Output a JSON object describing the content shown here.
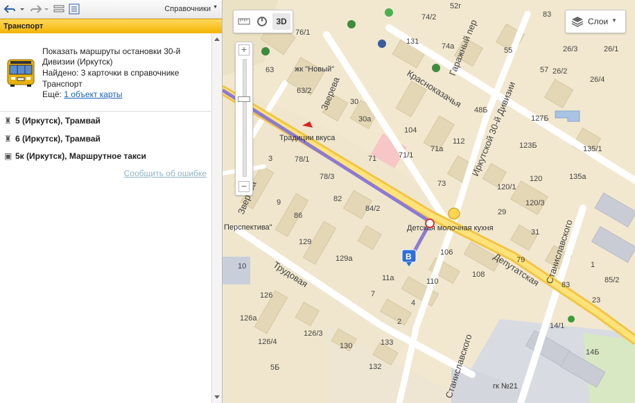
{
  "toolbar": {
    "directories_label": "Справочники"
  },
  "section": {
    "title": "Транспорт"
  },
  "card": {
    "line1": "Показать маршруты остановки 30-й",
    "line2": "Дивизии (Иркутск)",
    "line3": "Найдено: 3 карточки в справочнике",
    "line4": "Транспорт",
    "more_prefix": "Ещё:",
    "more_link": "1 объект карты"
  },
  "routes": [
    {
      "label": "5 (Иркутск), Трамвай",
      "icon": "tram-icon"
    },
    {
      "label": "6 (Иркутск), Трамвай",
      "icon": "tram-icon"
    },
    {
      "label": "5к (Иркутск), Маршрутное такси",
      "icon": "bus-icon"
    }
  ],
  "report_link": "Сообщить об ошибке",
  "map": {
    "view_3d": "3D",
    "layers_label": "Слои",
    "streets": {
      "krasnokazachya": "Красноказачья",
      "zvereva": "Зверева",
      "irkutskoy30": "Иркутской 30-й Дивизии",
      "garazhny": "Гаражный пер",
      "trudovaya": "Трудовая",
      "deputatskaya": "Депутатская",
      "stanislavskogo": "Станиславского"
    },
    "poi": {
      "tradition": "Традиции вкуса",
      "zhk": "жк \"Новый\"",
      "perspektiva": "Перспектива\"",
      "kitchen": "Детская молочная кухня",
      "gk": "гк №21"
    },
    "stop_marker": "В",
    "house_numbers": [
      "52г",
      "74/2",
      "76/1",
      "83",
      "131",
      "74а",
      "26/3",
      "26/1",
      "55",
      "63",
      "63/2",
      "57",
      "26/2",
      "26/4",
      "30",
      "48Б",
      "30а",
      "104",
      "127Б",
      "71а",
      "112",
      "123Б",
      "135/1",
      "71",
      "71/1",
      "78/1",
      "78/3",
      "73",
      "120/1",
      "120",
      "135а",
      "82",
      "84/2",
      "29",
      "120/3",
      "86",
      "31",
      "129",
      "129а",
      "106",
      "79",
      "108",
      "10",
      "11а",
      "110",
      "83",
      "85/2",
      "126",
      "7",
      "4",
      "126а",
      "2",
      "126/3",
      "126/4",
      "130",
      "133",
      "5Б",
      "132",
      "14/1",
      "14Б",
      "3",
      "9",
      "23",
      "1",
      "63/2"
    ]
  }
}
